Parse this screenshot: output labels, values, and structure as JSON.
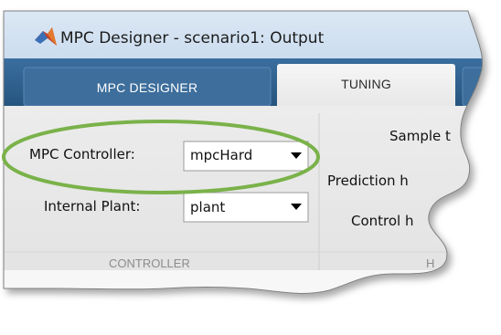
{
  "window": {
    "title": "MPC Designer - scenario1: Output"
  },
  "tabs": [
    {
      "label": "MPC DESIGNER",
      "active": false
    },
    {
      "label": "TUNING",
      "active": true
    }
  ],
  "controller_section": {
    "mpc_controller_label": "MPC Controller:",
    "mpc_controller_value": "mpcHard",
    "internal_plant_label": "Internal Plant:",
    "internal_plant_value": "plant",
    "section_label": "CONTROLLER"
  },
  "horizon_section": {
    "sample_time_label": "Sample t",
    "prediction_horizon_label": "Prediction h",
    "control_horizon_label": "Control h",
    "section_label": "H"
  },
  "colors": {
    "tab_bar": "#2e5d8a",
    "highlight_ellipse": "#7ab24a",
    "toolstrip": "#e9e9e9"
  }
}
